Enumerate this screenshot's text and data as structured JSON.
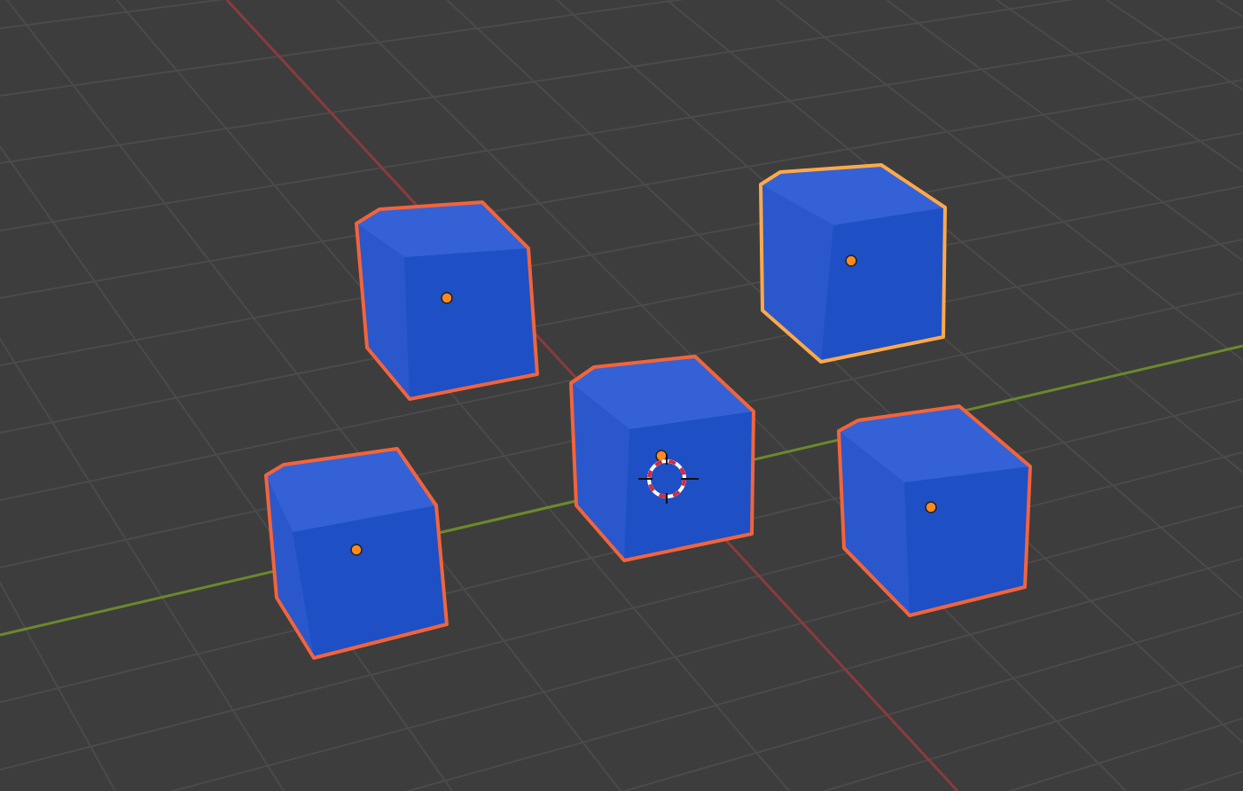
{
  "viewport": {
    "cubes": [
      {
        "selected": true,
        "active": false
      },
      {
        "selected": true,
        "active": true
      },
      {
        "selected": true,
        "active": false
      },
      {
        "selected": true,
        "active": false
      },
      {
        "selected": true,
        "active": false
      }
    ]
  }
}
